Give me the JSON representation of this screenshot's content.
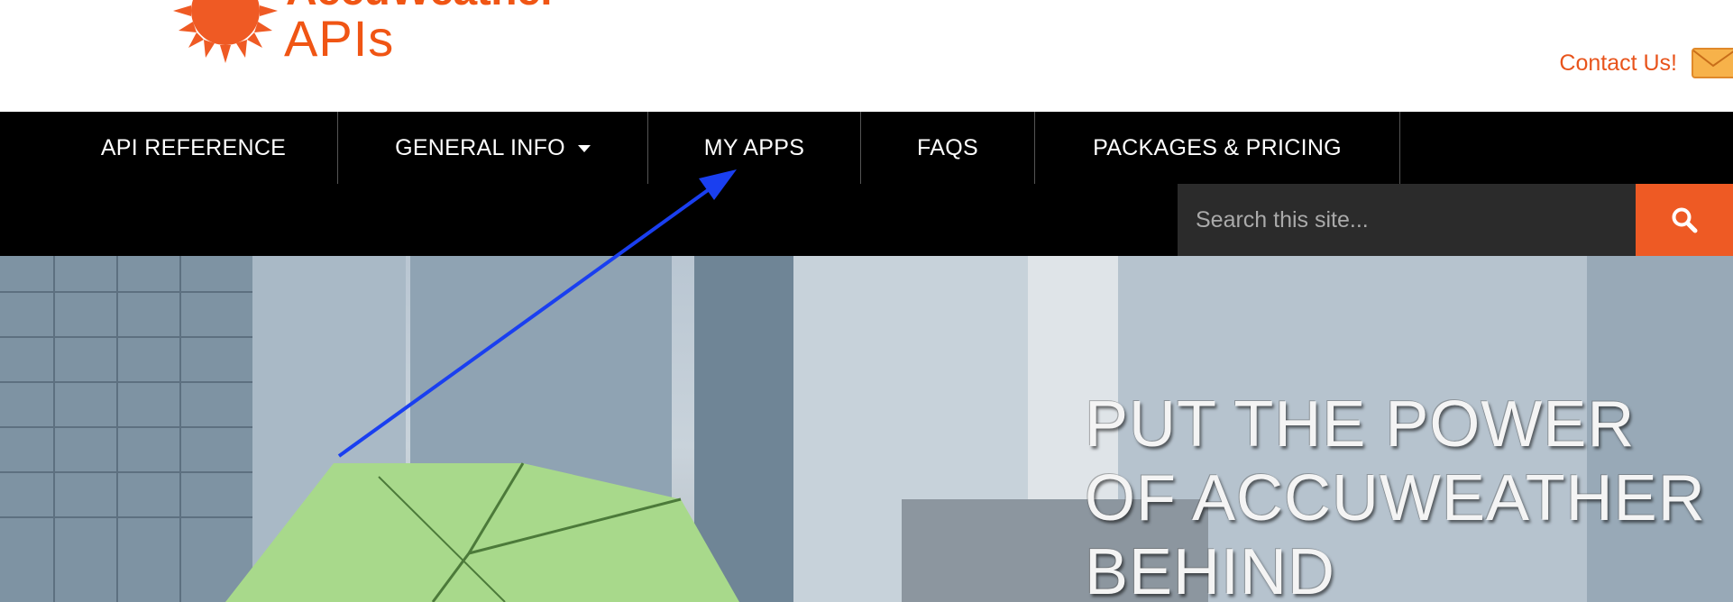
{
  "header": {
    "logo_top": "AccuWeather",
    "logo_sub": "APIs",
    "contact_label": "Contact Us!"
  },
  "nav": {
    "items": [
      {
        "label": "API REFERENCE"
      },
      {
        "label": "GENERAL INFO",
        "has_dropdown": true
      },
      {
        "label": "MY APPS"
      },
      {
        "label": "FAQS"
      },
      {
        "label": "PACKAGES & PRICING"
      }
    ]
  },
  "search": {
    "placeholder": "Search this site..."
  },
  "hero": {
    "line1": "PUT THE POWER",
    "line2": "OF ACCUWEATHER",
    "line3": "BEHIND"
  },
  "colors": {
    "brand_orange": "#f05514",
    "nav_bg": "#000000",
    "search_button": "#ee5a24",
    "annotation_arrow": "#1a3ff0"
  },
  "icons": [
    "sun-logo-icon",
    "mail-icon",
    "chevron-down-icon",
    "search-icon"
  ]
}
